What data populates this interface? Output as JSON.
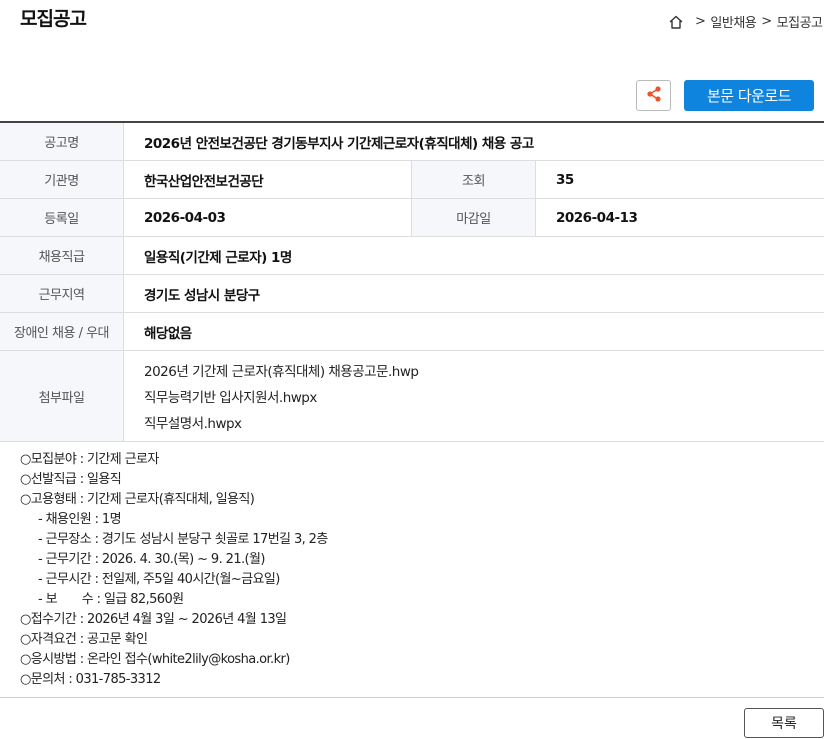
{
  "page": {
    "title": "모집공고"
  },
  "breadcrumb": {
    "items": [
      "일반채용",
      "모집공고"
    ],
    "separator": ">"
  },
  "toolbar": {
    "download_label": "본문 다운로드"
  },
  "table": {
    "title_label": "공고명",
    "title_value": "2026년 안전보건공단 경기동부지사 기간제근로자(휴직대체) 채용 공고",
    "org_label": "기관명",
    "org_value": "한국산업안전보건공단",
    "views_label": "조회",
    "views_value": "35",
    "reg_label": "등록일",
    "reg_value": "2026-04-03",
    "deadline_label": "마감일",
    "deadline_value": "2026-04-13",
    "grade_label": "채용직급",
    "grade_value": "일용직(기간제 근로자) 1명",
    "region_label": "근무지역",
    "region_value": "경기도 성남시 분당구",
    "disabled_label": "장애인 채용 / 우대",
    "disabled_value": "해당없음",
    "files_label": "첨부파일",
    "files": [
      "2026년 기간제 근로자(휴직대체) 채용공고문.hwp",
      "직무능력기반 입사지원서.hwpx",
      "직무설명서.hwpx"
    ]
  },
  "notice": {
    "lines": [
      "○모집분야 : 기간제 근로자",
      "○선발직급 : 일용직",
      "○고용형태 : 기간제 근로자(휴직대체, 일용직)"
    ],
    "sub_lines": [
      "- 채용인원 : 1명",
      "- 근무장소 : 경기도 성남시 분당구 쇳골로 17번길 3, 2층",
      "- 근무기간 : 2026. 4. 30.(목) ~ 9. 21.(월)",
      "- 근무시간 : 전일제, 주5일 40시간(월~금요일)",
      "- 보　　수 : 일급 82,560원"
    ],
    "lines_after": [
      "○접수기간 : 2026년 4월 3일 ~ 2026년 4월 13일",
      "○자격요건 : 공고문 확인",
      "○응시방법 : 온라인 접수(white2lily@kosha.or.kr)",
      "○문의처 : 031-785-3312"
    ]
  },
  "footer": {
    "list_label": "목록"
  },
  "colors": {
    "accent": "#0f84de",
    "header_bg": "#f5f7fa",
    "border": "#dddddd"
  },
  "icons": {
    "home": "home-icon",
    "share": "share-icon"
  }
}
